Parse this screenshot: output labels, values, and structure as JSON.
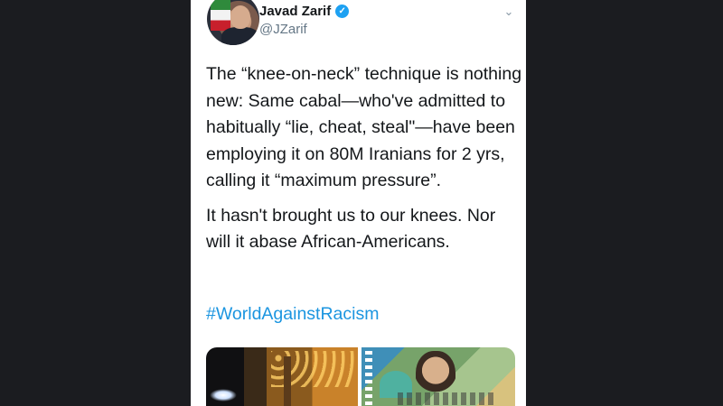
{
  "tweet": {
    "author_name": "Javad Zarif",
    "handle": "@JZarif",
    "verified_mark": "✓",
    "menu_glyph": "⌄",
    "paragraphs": [
      "The “knee-on-neck” technique is nothing new: Same cabal—who've admitted to habitually “lie, cheat, steal\"—have been employing it on 80M Iranians for 2 yrs, calling it “maximum pressure”.",
      "It hasn't brought us to our knees. Nor will it abase African-Americans."
    ],
    "hashtag": "#WorldAgainstRacism"
  },
  "colors": {
    "background": "#1b1c20",
    "card": "#ffffff",
    "text": "#14171a",
    "secondary": "#657786",
    "link": "#1b95e0",
    "verified": "#1da1f2"
  },
  "icons": [
    "avatar",
    "verified-badge-icon",
    "chevron-down-icon"
  ]
}
